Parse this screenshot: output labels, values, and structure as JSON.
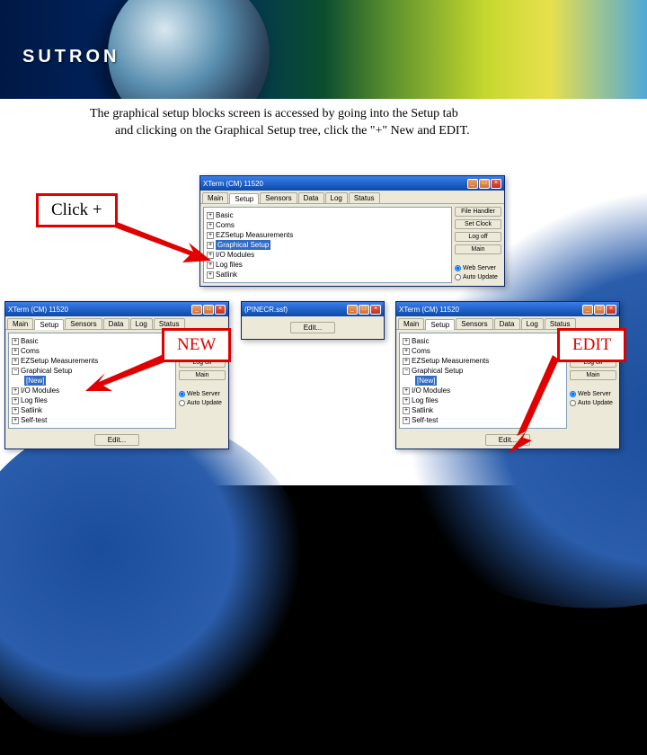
{
  "brand": "SUTRON",
  "intro": {
    "line1": "The graphical setup blocks screen is accessed by going into the Setup tab",
    "line2": "and clicking on the Graphical Setup tree, click the \"+\" New and EDIT."
  },
  "callouts": {
    "clickplus": "Click +",
    "new": "NEW",
    "edit": "EDIT"
  },
  "window": {
    "title": "XTerm (CM) 11520",
    "title_mid": "(PINECR.ssf)",
    "min": "_",
    "max": "□",
    "close": "×",
    "tabs": [
      "Main",
      "Setup",
      "Sensors",
      "Data",
      "Log",
      "Status"
    ],
    "side": {
      "filehandler": "File Handler",
      "setclock": "Set Clock",
      "logoff": "Log off",
      "main": "Main",
      "webserver": "Web Server",
      "autoupdate": "Auto Update"
    },
    "tree_top": {
      "items": [
        {
          "toggle": "+",
          "label": "Basic"
        },
        {
          "toggle": "+",
          "label": "Coms"
        },
        {
          "toggle": "+",
          "label": "EZSetup Measurements"
        },
        {
          "toggle": "+",
          "label": "Graphical Setup",
          "selected": true
        },
        {
          "toggle": "+",
          "label": "I/O Modules"
        },
        {
          "toggle": "+",
          "label": "Log files"
        },
        {
          "toggle": "+",
          "label": "Satlink"
        }
      ]
    },
    "tree_expanded": {
      "items": [
        {
          "toggle": "+",
          "label": "Basic"
        },
        {
          "toggle": "+",
          "label": "Coms"
        },
        {
          "toggle": "+",
          "label": "EZSetup Measurements"
        },
        {
          "toggle": "−",
          "label": "Graphical Setup"
        },
        {
          "toggle": "",
          "label": "[New]",
          "child": true,
          "selected": true
        },
        {
          "toggle": "+",
          "label": "I/O Modules"
        },
        {
          "toggle": "+",
          "label": "Log files"
        },
        {
          "toggle": "+",
          "label": "Satlink"
        },
        {
          "toggle": "+",
          "label": "Self-test"
        }
      ]
    },
    "edit_button": "Edit..."
  }
}
